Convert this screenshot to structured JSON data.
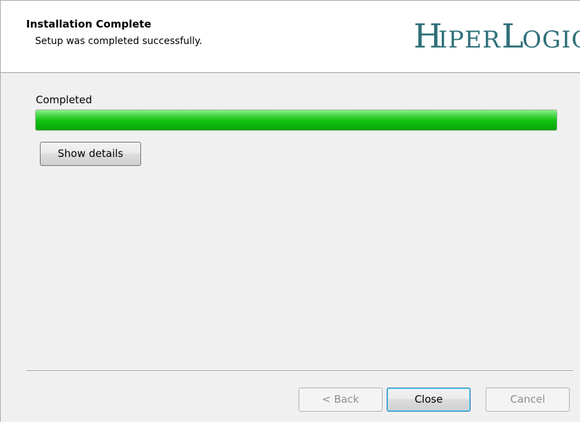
{
  "header": {
    "title": "Installation Complete",
    "subtitle": "Setup was completed successfully.",
    "logo_text": "HiperLogic"
  },
  "progress": {
    "label": "Completed",
    "value_percent": 100,
    "color": "#10c010"
  },
  "buttons": {
    "show_details": "Show details",
    "back": "< Back",
    "close": "Close",
    "cancel": "Cancel"
  }
}
